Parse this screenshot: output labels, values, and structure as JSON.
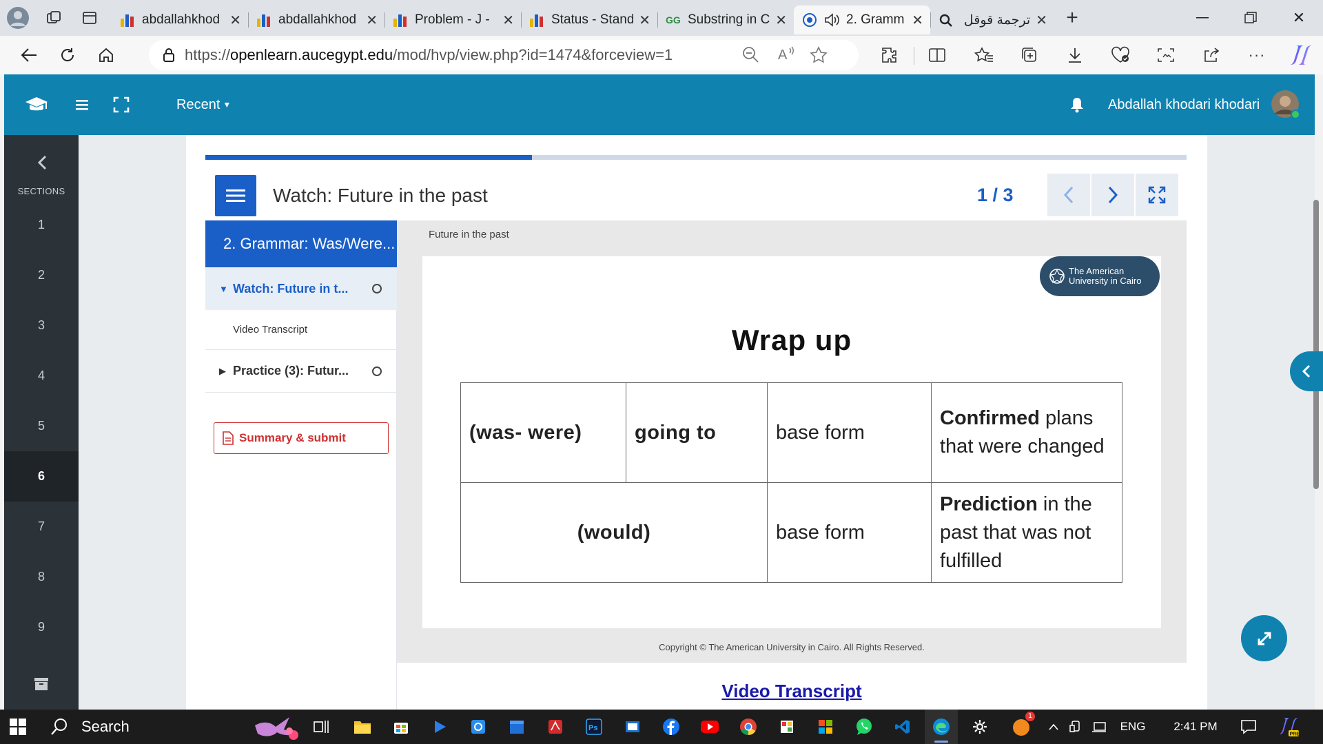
{
  "browser": {
    "tabs": [
      {
        "title": "abdallahkhod",
        "color": "#e6b400"
      },
      {
        "title": "abdallahkhod",
        "color": "#e6b400"
      },
      {
        "title": "Problem - J - ",
        "color": "#e6b400"
      },
      {
        "title": "Status - Stand",
        "color": "#e6b400"
      },
      {
        "title": "Substring in C",
        "color": "#2f8d46"
      },
      {
        "title": "2. Gramm",
        "color": "#1a5fc8",
        "active": true
      },
      {
        "title": "ترجمة قوقل -",
        "color": "#4285f4"
      }
    ],
    "url_scheme": "https://",
    "url_host": "openlearn.aucegypt.edu",
    "url_path": "/mod/hvp/view.php?id=1474&forceview=1"
  },
  "navbar": {
    "recent_label": "Recent",
    "user_name": "Abdallah khodari khodari",
    "brand_color": "#0f82b0"
  },
  "drawer": {
    "sections_label": "SECTIONS",
    "items": [
      "1",
      "2",
      "3",
      "4",
      "5",
      "6",
      "7",
      "8",
      "9"
    ],
    "active_item": "6"
  },
  "hvp": {
    "progress_fraction": 0.333,
    "title": "Watch: Future in the past",
    "page_counter": "1 / 3",
    "chapter_title": "2. Grammar: Was/Were...",
    "toc": [
      {
        "label": "Watch: Future in t...",
        "expanded": true
      },
      {
        "label": "Practice (3): Futur...",
        "expanded": false
      }
    ],
    "toc_subitem": "Video Transcript",
    "submit_label": "Summary & submit",
    "video_caption": "Future in the past",
    "logo_line1": "The American",
    "logo_line2": "University in Cairo",
    "slide_title": "Wrap up",
    "table": {
      "r1c1": "(was- were)",
      "r1c2": "going to",
      "r1c3": "base form",
      "r1c4_bold": "Confirmed",
      "r1c4_rest": " plans that were changed",
      "r2c1": "(would)",
      "r2c3": "base form",
      "r2c4_bold": "Prediction",
      "r2c4_rest": " in the past that was not fulfilled"
    },
    "copyright": "Copyright © The American University in Cairo. All Rights Reserved.",
    "transcript_link": "Video Transcript"
  },
  "taskbar": {
    "search_label": "Search",
    "lang": "ENG",
    "time": "2:41 PM",
    "badge_count": "1"
  }
}
